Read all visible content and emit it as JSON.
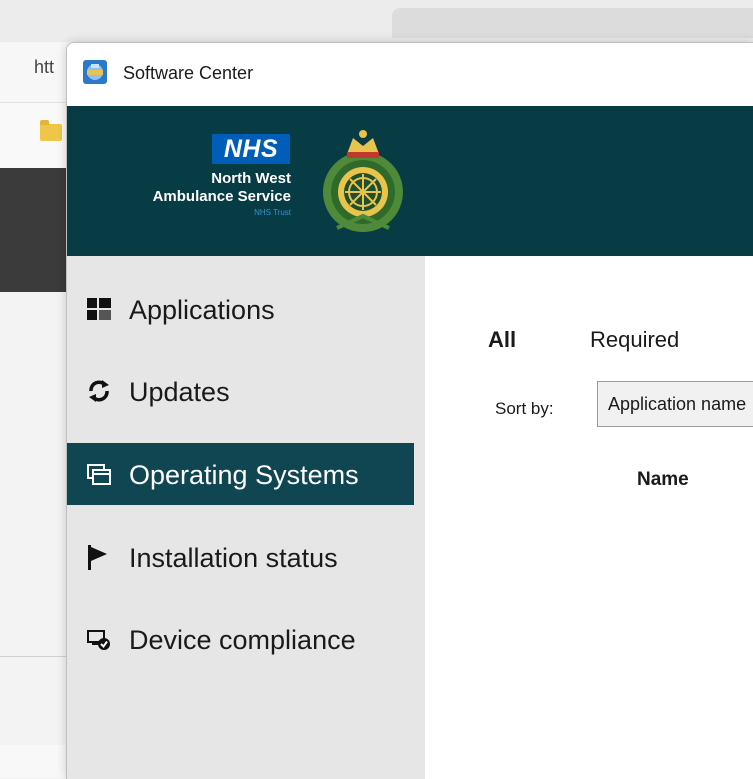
{
  "browser": {
    "url_fragment": "htt"
  },
  "window": {
    "title": "Software Center"
  },
  "banner": {
    "logo_text": "NHS",
    "org_name_line1": "North West",
    "org_name_line2": "Ambulance Service",
    "org_suffix": "NHS Trust"
  },
  "sidebar": {
    "items": [
      {
        "label": "Applications",
        "icon": "applications-grid-icon"
      },
      {
        "label": "Updates",
        "icon": "refresh-icon"
      },
      {
        "label": "Operating Systems",
        "icon": "windows-stack-icon",
        "active": true
      },
      {
        "label": "Installation status",
        "icon": "flag-icon"
      },
      {
        "label": "Device compliance",
        "icon": "device-compliance-icon"
      }
    ]
  },
  "content": {
    "tabs": [
      {
        "label": "All",
        "active": true
      },
      {
        "label": "Required"
      }
    ],
    "sort_label": "Sort by:",
    "sort_value": "Application name",
    "column_name": "Name"
  },
  "colors": {
    "banner": "#073c44",
    "active_nav": "#0f4651",
    "sidebar": "#e6e6e6",
    "nhs_blue": "#005eb8"
  }
}
